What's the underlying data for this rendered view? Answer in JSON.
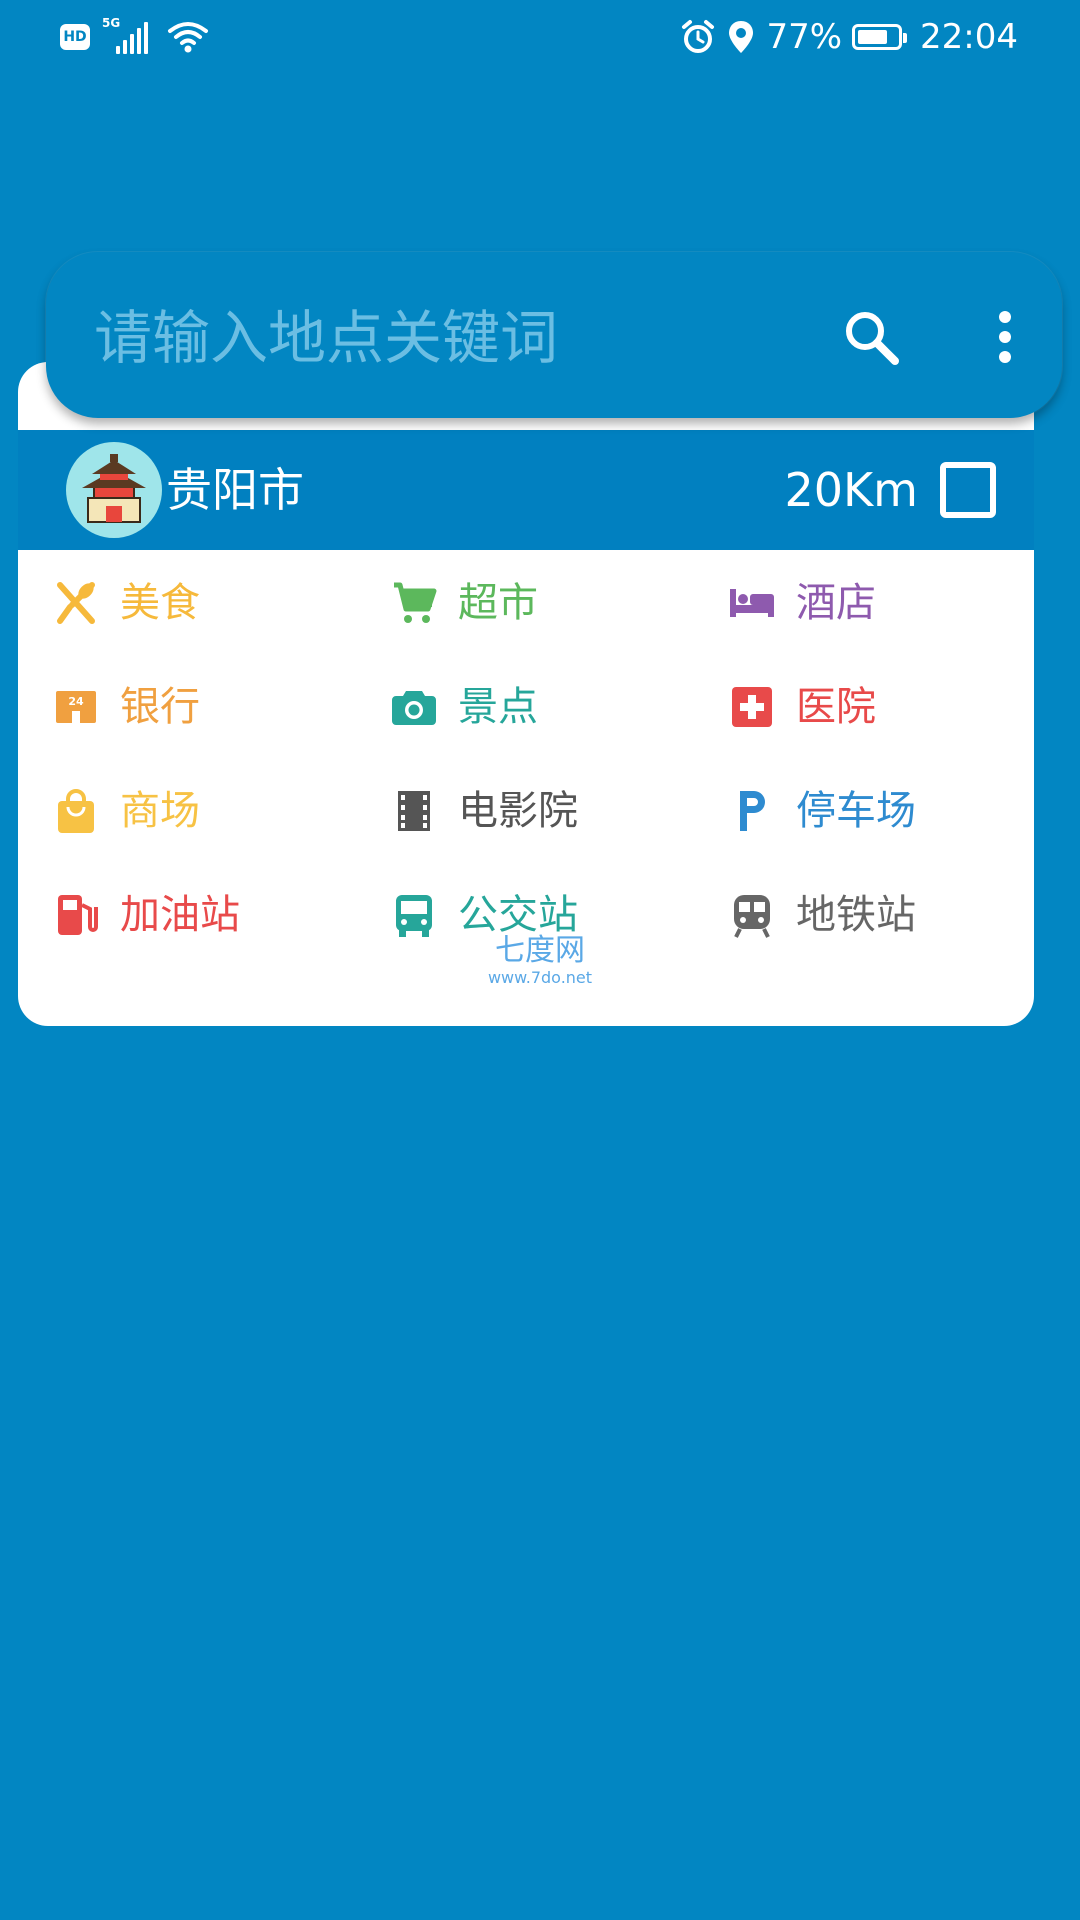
{
  "status_bar": {
    "hd": "HD",
    "network": "5G",
    "battery": "77%",
    "battery_level": 0.77,
    "time": "22:04"
  },
  "search": {
    "placeholder": "请输入地点关键词",
    "search_icon": "search-icon",
    "more_icon": "more-vert-icon"
  },
  "city": {
    "name": "贵阳市",
    "distance": "20Km",
    "checkbox_checked": false,
    "avatar_icon": "city-gate-icon"
  },
  "categories": [
    {
      "label": "美食",
      "icon": "restaurant-icon",
      "color": "#F6B93B"
    },
    {
      "label": "超市",
      "icon": "shopping-cart-icon",
      "color": "#5CB85C"
    },
    {
      "label": "酒店",
      "icon": "hotel-bed-icon",
      "color": "#8E5AAE"
    },
    {
      "label": "银行",
      "icon": "bank-24h-icon",
      "color": "#F0A040"
    },
    {
      "label": "景点",
      "icon": "camera-icon",
      "color": "#26A69A"
    },
    {
      "label": "医院",
      "icon": "hospital-cross-icon",
      "color": "#E84A4A"
    },
    {
      "label": "商场",
      "icon": "shopping-bag-icon",
      "color": "#F7C244"
    },
    {
      "label": "电影院",
      "icon": "film-icon",
      "color": "#555555"
    },
    {
      "label": "停车场",
      "icon": "parking-icon",
      "color": "#2E8BD0"
    },
    {
      "label": "加油站",
      "icon": "gas-station-icon",
      "color": "#E84A4A"
    },
    {
      "label": "公交站",
      "icon": "bus-icon",
      "color": "#26A69A"
    },
    {
      "label": "地铁站",
      "icon": "subway-icon",
      "color": "#666666"
    }
  ],
  "watermark": {
    "main": "七度网",
    "sub": "www.7do.net"
  }
}
